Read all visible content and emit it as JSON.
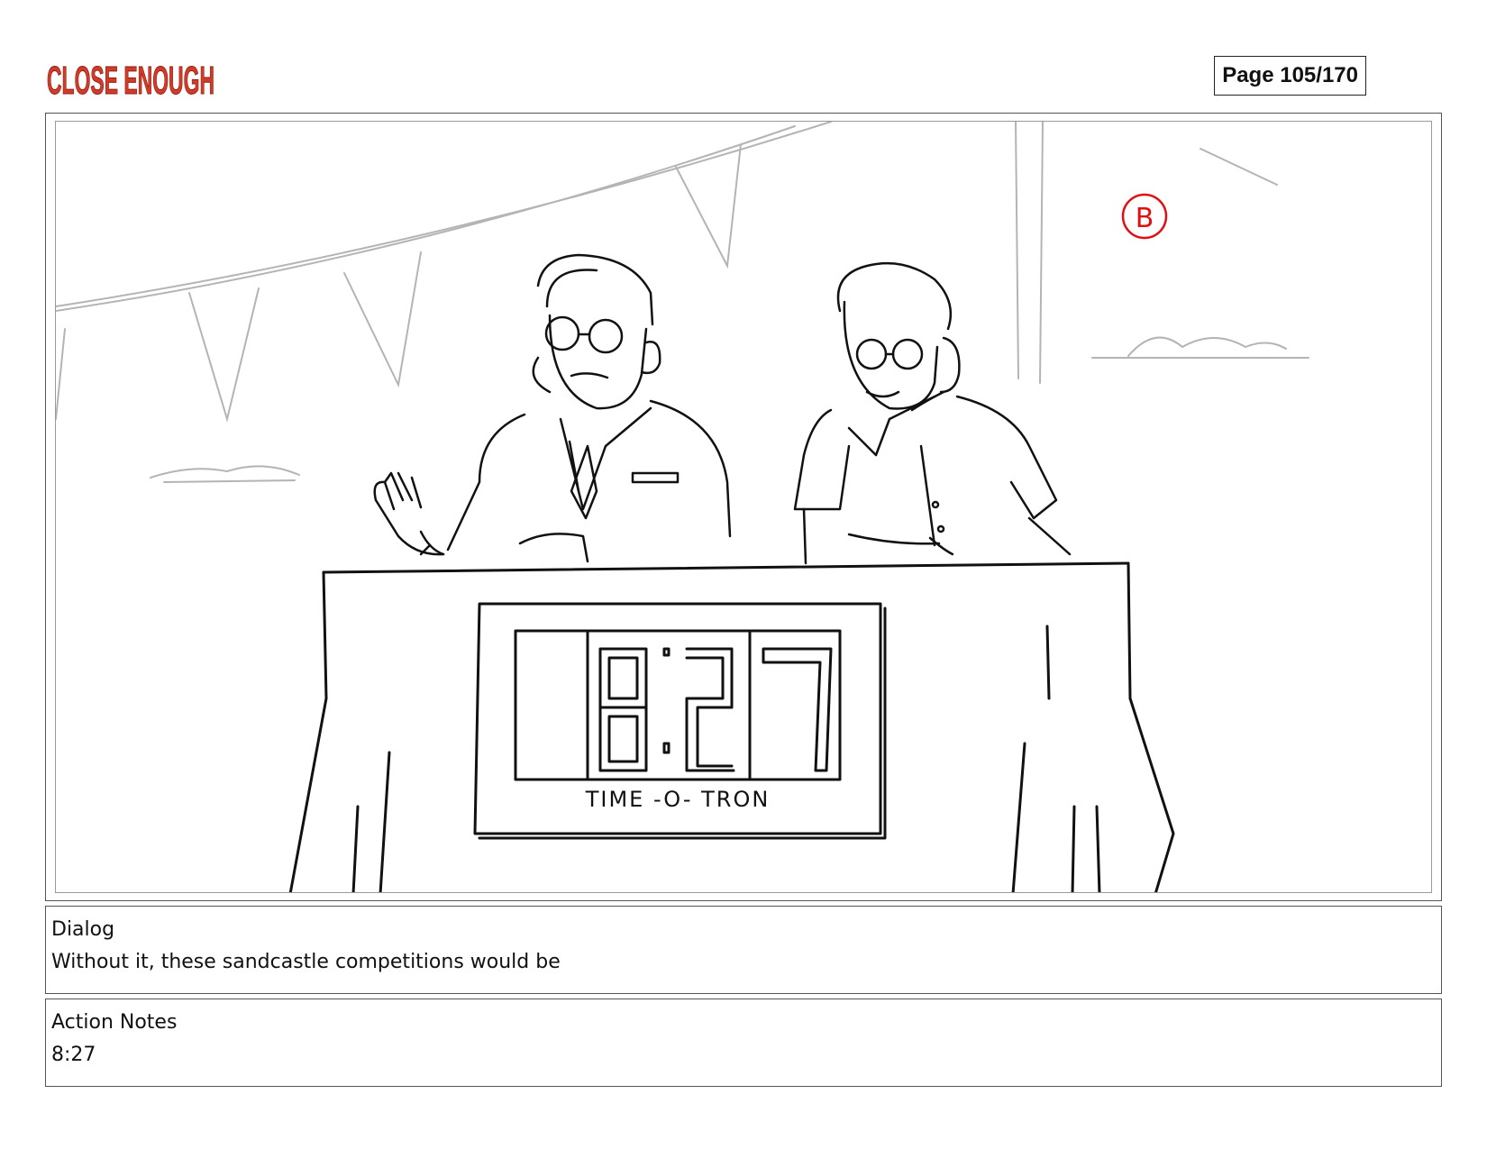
{
  "header": {
    "logo_text": "CLOSE ENOUGH",
    "page_indicator": "Page 105/170"
  },
  "panel": {
    "prop_label": "TIME -O- TRON",
    "scene_marker": "B",
    "colors": {
      "line": "#111111",
      "sketch": "#b4b4b4",
      "marker": "#e01010",
      "logo": "#d23a2a"
    }
  },
  "dialog": {
    "label": "Dialog",
    "text": "Without it, these sandcastle competitions would be"
  },
  "action_notes": {
    "label": "Action Notes",
    "text": "8:27"
  }
}
